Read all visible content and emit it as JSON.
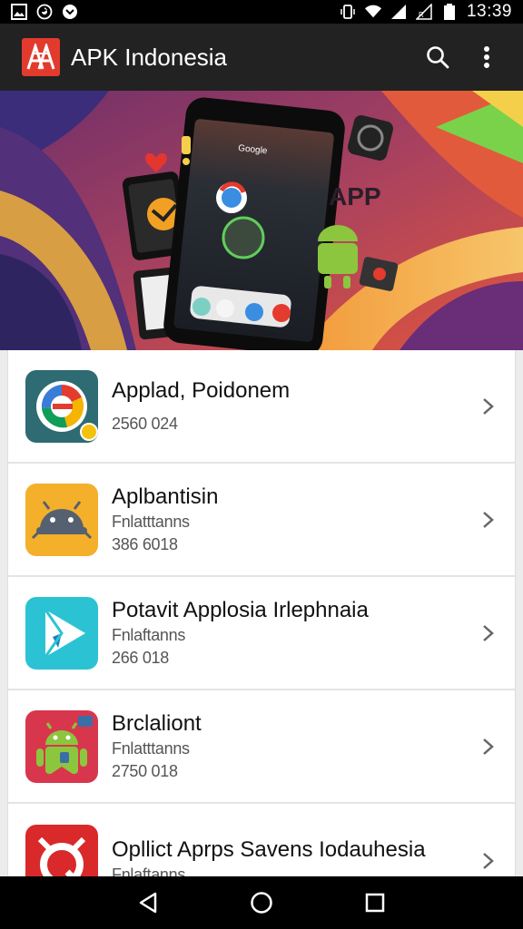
{
  "status_bar": {
    "time": "13:39",
    "left_icons": [
      "gallery-icon",
      "refresh-icon",
      "notification-icon"
    ],
    "right_icons": [
      "vibrate-icon",
      "wifi-icon",
      "signal-icon",
      "signal-roaming-icon",
      "battery-icon"
    ]
  },
  "app_bar": {
    "title": "APK Indonesia",
    "actions": [
      "search-icon",
      "overflow-menu-icon"
    ]
  },
  "banner": {
    "phone_header": "Google",
    "app_text": "APP"
  },
  "apps": [
    {
      "title": "Applad, Poidonem",
      "subtitle": "",
      "meta": "2560 024",
      "icon": "chrome-style-icon",
      "icon_color": "#2e6b73"
    },
    {
      "title": "Aplbantisin",
      "subtitle": "Fnlatttanns",
      "meta": "386 6018",
      "icon": "android-robot-icon",
      "icon_color": "#f4b02a"
    },
    {
      "title": "Potavit Applosia Irlephnaia",
      "subtitle": "Fnlaftanns",
      "meta": "266 018",
      "icon": "play-store-icon",
      "icon_color": "#2bc3d3"
    },
    {
      "title": "Brclaliont",
      "subtitle": "Fnlatttanns",
      "meta": "2750 018",
      "icon": "android-bug-icon",
      "icon_color": "#d8364d"
    },
    {
      "title": "Opllict Aprps Savens Iodauhesia",
      "subtitle": "Fnlaftanns",
      "meta": "",
      "icon": "camera-lens-icon",
      "icon_color": "#d9292a"
    }
  ],
  "nav_bar": [
    "back-icon",
    "home-icon",
    "recents-icon"
  ],
  "colors": {
    "app_bar": "#222222",
    "status_bar": "#000000",
    "logo": "#e23b2e",
    "list_background": "#ffffff"
  }
}
